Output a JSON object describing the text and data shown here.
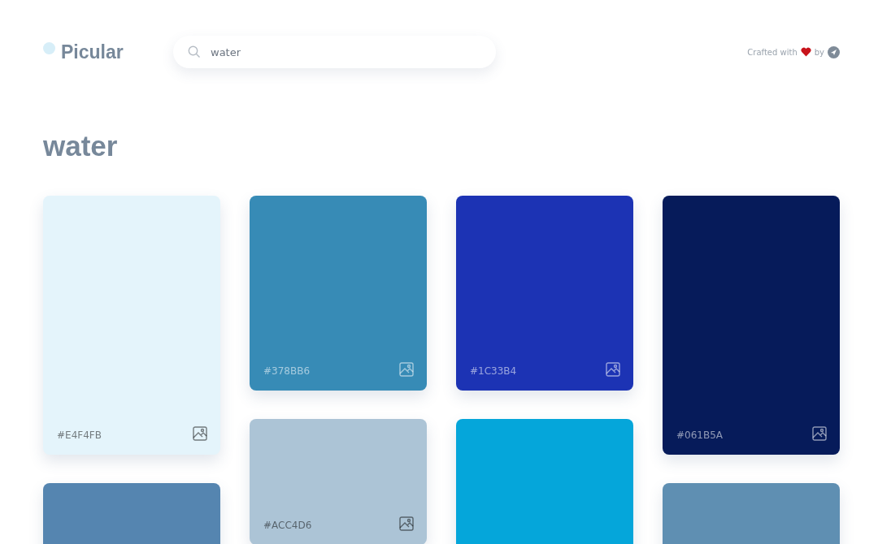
{
  "header": {
    "logo": "Picular",
    "search": {
      "value": "water"
    },
    "credit": {
      "before": "Crafted with",
      "after": "by"
    }
  },
  "title": "water",
  "columns": [
    {
      "cards": [
        {
          "kind": "tall",
          "color": "#e4f4fb",
          "label": "#E4F4FB"
        },
        {
          "kind": "tall",
          "color": "#5585b0"
        }
      ]
    },
    {
      "cards": [
        {
          "kind": "short",
          "color": "#378bb6",
          "label": "#378BB6"
        },
        {
          "kind": "small",
          "color": "#acc4d6",
          "label": "#ACC4D6"
        }
      ]
    },
    {
      "cards": [
        {
          "kind": "short",
          "color": "#1c33b4",
          "label": "#1C33B4"
        },
        {
          "kind": "tall",
          "color": "#05a6da"
        }
      ]
    },
    {
      "cards": [
        {
          "kind": "tall",
          "color": "#061b5a",
          "label": "#061B5A"
        },
        {
          "kind": "tall",
          "color": "#5f8fb2"
        }
      ]
    }
  ]
}
